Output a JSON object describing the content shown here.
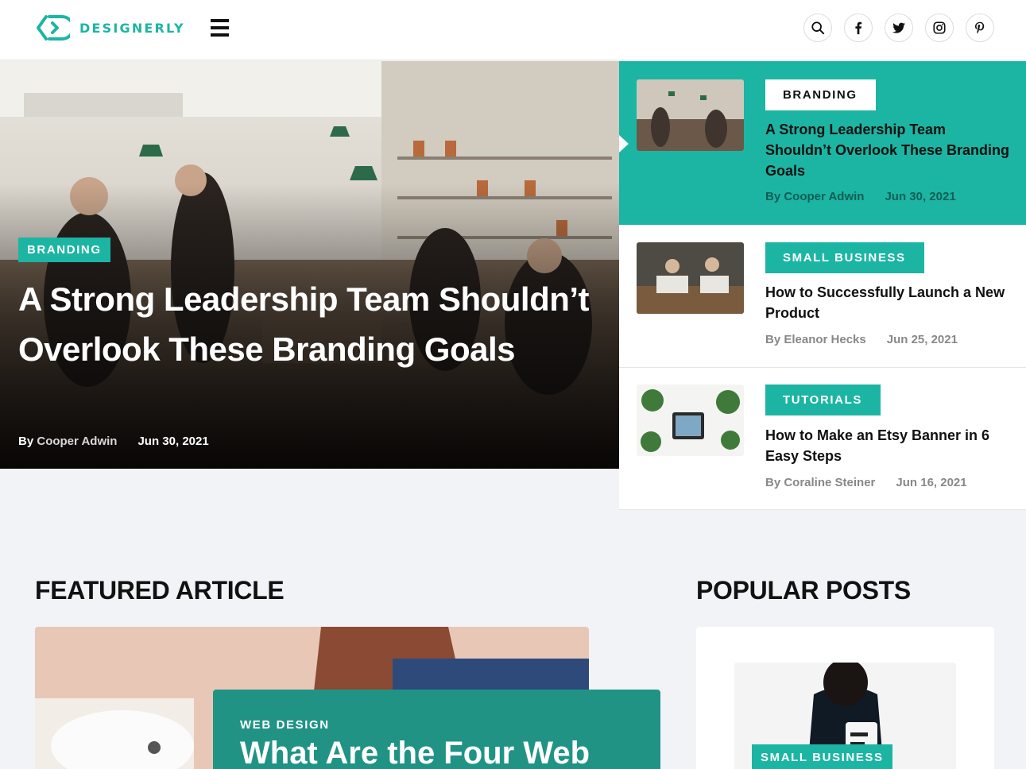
{
  "brand": {
    "name": "DESIGNERLY",
    "accent": "#1cb5a3",
    "dark_accent": "#219385"
  },
  "header": {
    "social": [
      "search-icon",
      "facebook-icon",
      "twitter-icon",
      "instagram-icon",
      "pinterest-icon"
    ]
  },
  "hero": {
    "tag": "BRANDING",
    "title": "A Strong Leadership Team Shouldn’t Overlook These Branding Goals",
    "by": "By",
    "author": "Cooper Adwin",
    "date": "Jun 30, 2021"
  },
  "side_posts": [
    {
      "tag": "BRANDING",
      "title": "A Strong Leadership Team Shouldn’t Overlook These Branding Goals",
      "author": "By Cooper Adwin",
      "date": "Jun 30, 2021"
    },
    {
      "tag": "SMALL BUSINESS",
      "title": "How to Successfully Launch a New Product",
      "author": "By Eleanor Hecks",
      "date": "Jun 25, 2021"
    },
    {
      "tag": "TUTORIALS",
      "title": "How to Make an Etsy Banner in 6 Easy Steps",
      "author": "By Coraline Steiner",
      "date": "Jun 16, 2021"
    }
  ],
  "featured": {
    "heading": "FEATURED ARTICLE",
    "category": "WEB DESIGN",
    "title": "What Are the Four Web"
  },
  "popular": {
    "heading": "POPULAR POSTS",
    "tag": "SMALL BUSINESS"
  }
}
